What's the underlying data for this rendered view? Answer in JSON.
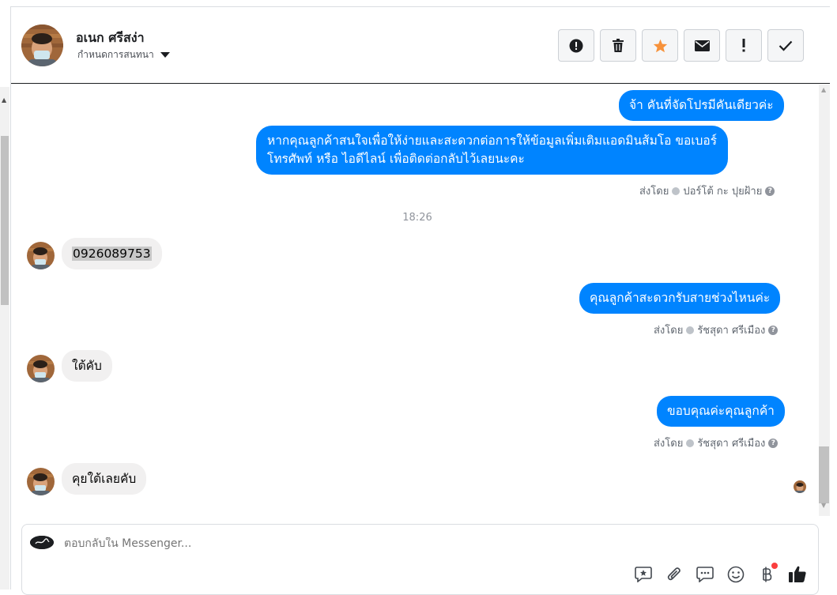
{
  "contact": {
    "name": "อเนก ศรีสง่า",
    "assign_label": "กำหนดการสนทนา"
  },
  "header_actions": [
    {
      "icon": "alert-circle-icon"
    },
    {
      "icon": "trash-icon"
    },
    {
      "icon": "star-icon",
      "color": "#f7923b"
    },
    {
      "icon": "envelope-icon"
    },
    {
      "icon": "exclamation-icon"
    },
    {
      "icon": "checkmark-icon"
    }
  ],
  "messages": {
    "m1": {
      "text": "จ้า คันที่จัดโปรมีคันเดียวค่ะ"
    },
    "m2": {
      "line1": "หากคุณลูกค้าสนใจเพื่อให้ง่ายและสะดวกต่อการให้ข้อมูลเพิ่มเติมแอดมินส้มโอ ขอเบอร์",
      "line2": "โทรศัพท์ หรือ ไอดีไลน์ เพื่อติดต่อกลับไว้เลยนะคะ"
    },
    "m2_sent_by": {
      "label": "ส่งโดย",
      "agent": "ปอร์โต้ กะ ปุยฝ้าย"
    },
    "time_separator": "18:26",
    "m3": {
      "text": "0926089753"
    },
    "m4": {
      "text": "คุณลูกค้าสะดวกรับสายช่วงไหนค่ะ"
    },
    "m4_sent_by": {
      "label": "ส่งโดย",
      "agent": "รัชสุดา ศรีเมือง"
    },
    "m5": {
      "text": "ใต้คับ"
    },
    "m6": {
      "text": "ขอบคุณค่ะคุณลูกค้า"
    },
    "m6_sent_by": {
      "label": "ส่งโดย",
      "agent": "รัชสุดา ศรีเมือง"
    },
    "m7": {
      "text": "คุยใต้เลยคับ"
    }
  },
  "composer": {
    "placeholder": "ตอบกลับใน Messenger...",
    "tools": [
      "saved-reply-icon",
      "paperclip-icon",
      "comment-icon",
      "emoji-icon",
      "baht-icon",
      "thumbs-up-icon"
    ]
  },
  "colors": {
    "outgoing_bubble": "#0084ff",
    "incoming_bubble": "#f1f0f0",
    "accent_star": "#f7923b"
  }
}
